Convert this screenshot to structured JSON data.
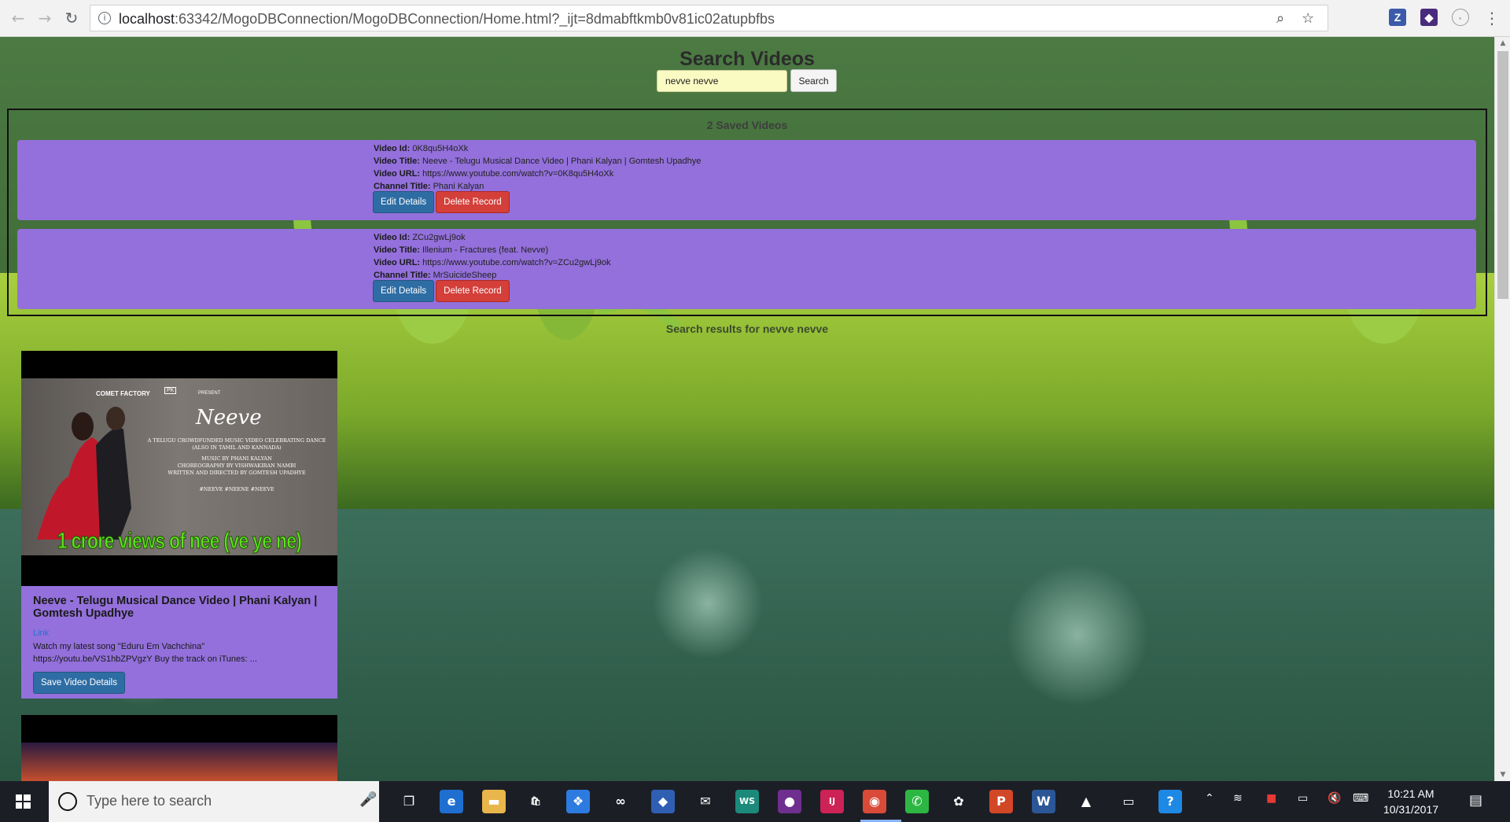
{
  "browser": {
    "url_host": "localhost",
    "url_rest": ":63342/MogoDBConnection/MogoDBConnection/Home.html?_ijt=8dmabftkmb0v81ic02atupbfbs",
    "icons": [
      "back-arrow-icon",
      "forward-arrow-icon",
      "reload-icon",
      "info-icon",
      "zoom-icon",
      "star-icon"
    ],
    "extensions": [
      {
        "name": "zotero-extension-icon",
        "label": "Z",
        "color": "#3b5aa9"
      },
      {
        "name": "extension-icon",
        "label": "◆",
        "color": "#4a2c7d"
      },
      {
        "name": "extension-circle-icon",
        "label": "◯",
        "color": "#9a9a9a"
      }
    ]
  },
  "page": {
    "title": "Search Videos",
    "search": {
      "value": "nevve nevve",
      "button": "Search"
    },
    "saved": {
      "heading": "2 Saved Videos",
      "labels": {
        "id": "Video Id:",
        "title": "Video Title:",
        "url": "Video URL:",
        "channel": "Channel Title:"
      },
      "videos": [
        {
          "id": "0K8qu5H4oXk",
          "title": "Neeve - Telugu Musical Dance Video | Phani Kalyan | Gomtesh Upadhye",
          "url": "https://www.youtube.com/watch?v=0K8qu5H4oXk",
          "channel": "Phani Kalyan",
          "edit": "Edit Details",
          "delete": "Delete Record"
        },
        {
          "id": "ZCu2gwLj9ok",
          "title": "Illenium - Fractures (feat. Nevve)",
          "url": "https://www.youtube.com/watch?v=ZCu2gwLj9ok",
          "channel": "MrSuicideSheep",
          "edit": "Edit Details",
          "delete": "Delete Record"
        }
      ]
    },
    "results": {
      "heading": "Search results for nevve nevve",
      "items": [
        {
          "title": "Neeve - Telugu Musical Dance Video | Phani Kalyan | Gomtesh Upadhye",
          "link": "Link",
          "description": "Watch my latest song \"Eduru Em Vachchina\" https://youtu.be/VS1hbZPVgzY Buy the track on iTunes: ...",
          "save": "Save Video Details",
          "thumb": {
            "brand": "COMET FACTORY",
            "present": "PRESENT",
            "logo": "PK",
            "script_title": "Neeve",
            "lines": [
              "A TELUGU CROWDFUNDED MUSIC VIDEO CELEBRATING DANCE",
              "(ALSO IN TAMIL AND KANNADA)",
              "MUSIC BY PHANI KALYAN",
              "CHOREOGRAPHY BY VISHWAKIRAN NAMBI",
              "WRITTEN AND DIRECTED BY GOMTESH UPADHYE",
              "#NEEVE #NEENE #NEEVE"
            ],
            "banner": "1 crore views of nee (ve ye ne)"
          }
        }
      ]
    }
  },
  "taskbar": {
    "search_placeholder": "Type here to search",
    "time": "10:21 AM",
    "date": "10/31/2017",
    "apps": [
      {
        "name": "task-view-icon",
        "glyph": "❐",
        "color": "transparent"
      },
      {
        "name": "edge-icon",
        "glyph": "e",
        "color": "#1e6fd0"
      },
      {
        "name": "file-explorer-icon",
        "glyph": "▬",
        "color": "#e8b64a"
      },
      {
        "name": "store-icon",
        "glyph": "🛍",
        "color": "transparent"
      },
      {
        "name": "dropbox-icon",
        "glyph": "❖",
        "color": "#2d7be0"
      },
      {
        "name": "infinity-app-icon",
        "glyph": "∞",
        "color": "transparent"
      },
      {
        "name": "sourcetree-icon",
        "glyph": "◆",
        "color": "#2f5fb3"
      },
      {
        "name": "mail-icon",
        "glyph": "✉",
        "color": "transparent"
      },
      {
        "name": "webstorm-icon",
        "glyph": "WS",
        "color": "#1b8a7a"
      },
      {
        "name": "github-icon",
        "glyph": "●",
        "color": "#6e2f8e"
      },
      {
        "name": "intellij-icon",
        "glyph": "IJ",
        "color": "#cc2255"
      },
      {
        "name": "chrome-icon",
        "glyph": "◉",
        "color": "#d94a38"
      },
      {
        "name": "whatsapp-icon",
        "glyph": "✆",
        "color": "#2cb742"
      },
      {
        "name": "paint-app-icon",
        "glyph": "✿",
        "color": "transparent"
      },
      {
        "name": "powerpoint-icon",
        "glyph": "P",
        "color": "#d24726"
      },
      {
        "name": "word-icon",
        "glyph": "W",
        "color": "#2b5797"
      },
      {
        "name": "photos-icon",
        "glyph": "▲",
        "color": "transparent"
      },
      {
        "name": "connect-icon",
        "glyph": "▭",
        "color": "transparent"
      },
      {
        "name": "help-icon",
        "glyph": "?",
        "color": "#1e88e5"
      }
    ],
    "tray": [
      "chevron-up-icon",
      "wifi-icon",
      "gift-icon",
      "battery-icon",
      "volume-muted-icon",
      "keyboard-icon"
    ]
  },
  "colors": {
    "card": "#9370db",
    "primary_btn": "#2e6da4",
    "danger_btn": "#d43f3a",
    "search_bg": "#fafac3"
  }
}
